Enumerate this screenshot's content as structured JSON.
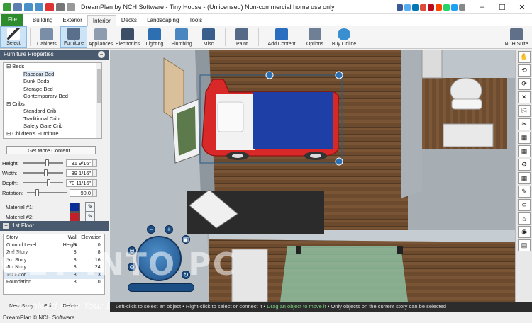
{
  "window": {
    "title": "DreamPlan by NCH Software - Tiny House - (Unlicensed) Non-commercial home use only",
    "social_colors": [
      "#3b5998",
      "#55acee",
      "#0077b5",
      "#dd4b39",
      "#bd081c",
      "#ff4500",
      "#25d366",
      "#1da1f2",
      "#888888"
    ]
  },
  "menu": {
    "file": "File",
    "tabs": [
      "Building",
      "Exterior",
      "Interior",
      "Decks",
      "Landscaping",
      "Tools"
    ],
    "active_tab": "Interior"
  },
  "ribbon": {
    "select": "Select",
    "cabinets": "Cabinets",
    "furniture": "Furniture",
    "appliances": "Appliances",
    "electronics": "Electronics",
    "lighting": "Lighting",
    "plumbing": "Plumbing",
    "misc": "Misc",
    "paint": "Paint",
    "add_content": "Add Content",
    "options": "Options",
    "buy_online": "Buy Online",
    "nch_suite": "NCH Suite"
  },
  "furniture_panel": {
    "title": "Furniture Properties",
    "tree": [
      {
        "label": "Beds",
        "level": 0,
        "expander": "⊟"
      },
      {
        "label": "Racecar Bed",
        "level": 1,
        "selected": true
      },
      {
        "label": "Bunk Beds",
        "level": 1
      },
      {
        "label": "Storage Bed",
        "level": 1
      },
      {
        "label": "Contemporary Bed",
        "level": 1
      },
      {
        "label": "Cribs",
        "level": 0,
        "expander": "⊟"
      },
      {
        "label": "Standard Crib",
        "level": 1
      },
      {
        "label": "Traditional Crib",
        "level": 1
      },
      {
        "label": "Safety Gate Crib",
        "level": 1
      },
      {
        "label": "Children's Furniture",
        "level": 0,
        "expander": "⊟"
      },
      {
        "label": "Toy Chest",
        "level": 1
      }
    ],
    "get_more": "Get More Content...",
    "height_label": "Height:",
    "height_value": "31 9/16\"",
    "width_label": "Width:",
    "width_value": "39 1/16\"",
    "depth_label": "Depth:",
    "depth_value": "70 11/16\"",
    "rotation_label": "Rotation:",
    "rotation_value": "90.0",
    "material1_label": "Material #1:",
    "material1_color": "#0b2d9a",
    "material2_label": "Material #2:",
    "material2_color": "#c0202a"
  },
  "floor_panel": {
    "title": "1st Floor",
    "headers": [
      "Story",
      "Wall Height",
      "Elevation"
    ],
    "rows": [
      [
        "Ground Level",
        "8'",
        "0'"
      ],
      [
        "2nd Story",
        "8'",
        "8'"
      ],
      [
        "3rd Story",
        "8'",
        "16'"
      ],
      [
        "4th Story",
        "8'",
        "24'"
      ],
      [
        "1st Floor",
        "8'",
        "3'"
      ],
      [
        "Foundation",
        "3'",
        "0'"
      ]
    ],
    "selected_row": 4,
    "buttons": [
      "New Story",
      "Edit",
      "Delete"
    ]
  },
  "hint": {
    "part1": "Left-click to select an object • Right-click to select or connect it • ",
    "part2": "Drag an object to move it",
    "part3": " • Only objects on the current story can be selected"
  },
  "statusbar": "DreamPlan © NCH Software",
  "watermark": {
    "text": "GET INTO PC",
    "sub": "Download Free Your Desired App"
  },
  "right_tools": [
    "hand-icon",
    "rotate-icon",
    "orbit-icon",
    "delete-icon",
    "copy-icon",
    "cut-icon",
    "grass-icon",
    "grass-alt-icon",
    "gear-icon",
    "grid-icon",
    "paint-icon",
    "magnet-icon",
    "shop-icon",
    "camera-icon",
    "render-icon"
  ]
}
